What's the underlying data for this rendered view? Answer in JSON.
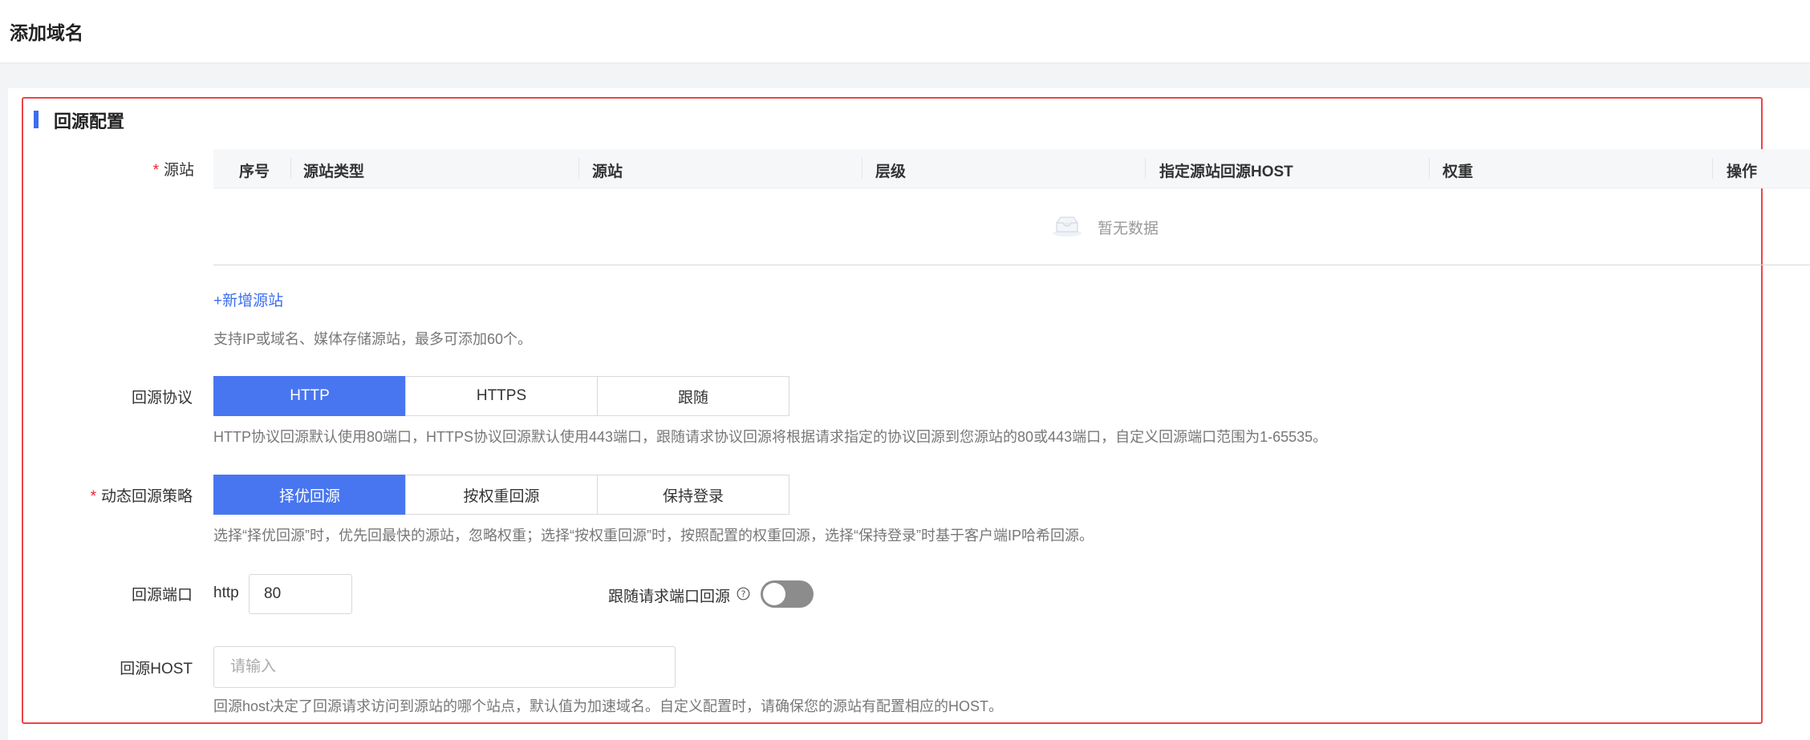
{
  "page": {
    "title": "添加域名"
  },
  "section": {
    "title": "回源配置"
  },
  "origin": {
    "label": "源站",
    "required_mark": "*",
    "table": {
      "columns": [
        "序号",
        "源站类型",
        "源站",
        "层级",
        "指定源站回源HOST",
        "权重",
        "操作"
      ],
      "rows": [],
      "empty_text": "暂无数据"
    },
    "add_link": "+新增源站",
    "hint": "支持IP或域名、媒体存储源站，最多可添加60个。"
  },
  "protocol": {
    "label": "回源协议",
    "options": [
      "HTTP",
      "HTTPS",
      "跟随"
    ],
    "selected": "HTTP",
    "hint": "HTTP协议回源默认使用80端口，HTTPS协议回源默认使用443端口，跟随请求协议回源将根据请求指定的协议回源到您源站的80或443端口，自定义回源端口范围为1-65535。"
  },
  "strategy": {
    "label": "动态回源策略",
    "required_mark": "*",
    "options": [
      "择优回源",
      "按权重回源",
      "保持登录"
    ],
    "selected": "择优回源",
    "hint": "选择“择优回源”时，优先回最快的源站，忽略权重；选择“按权重回源”时，按照配置的权重回源，选择“保持登录”时基于客户端IP哈希回源。"
  },
  "port": {
    "label": "回源端口",
    "protocol_text": "http",
    "value": "80",
    "follow_label": "跟随请求端口回源",
    "follow_enabled": false
  },
  "host": {
    "label": "回源HOST",
    "placeholder": "请输入",
    "value": "",
    "hint": "回源host决定了回源请求访问到源站的哪个站点，默认值为加速域名。自定义配置时，请确保您的源站有配置相应的HOST。"
  },
  "colors": {
    "accent": "#4876f0",
    "highlight_border": "#ef4444",
    "required": "#f5222d"
  }
}
